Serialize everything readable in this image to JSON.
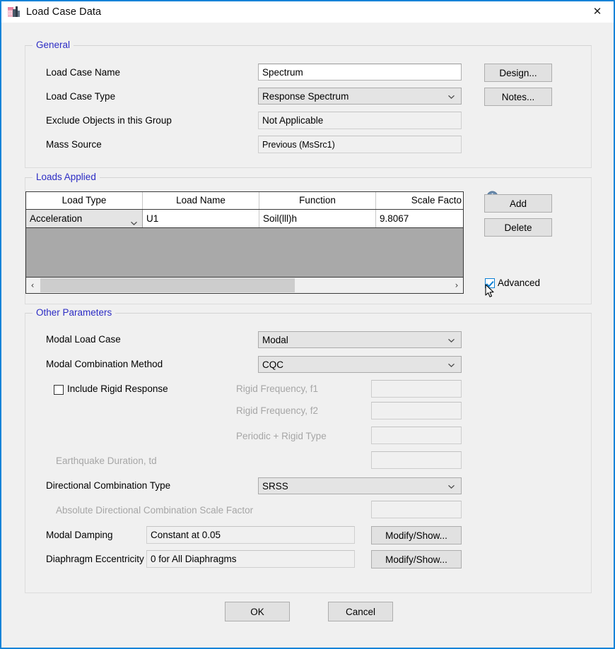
{
  "window": {
    "title": "Load Case Data",
    "icon": "app-building-icon",
    "close_label": "✕",
    "accent_border": "#1683d8"
  },
  "general": {
    "legend": "General",
    "rows": [
      {
        "label": "Load Case Name",
        "value": "Spectrum",
        "kind": "textbox"
      },
      {
        "label": "Load Case Type",
        "value": "Response Spectrum",
        "kind": "combo"
      },
      {
        "label": "Exclude Objects in this Group",
        "value": "Not Applicable",
        "kind": "flat"
      },
      {
        "label": "Mass Source",
        "value": "Previous  (MsSrc1)",
        "kind": "flat-small"
      }
    ],
    "buttons": [
      {
        "label": "Design..."
      },
      {
        "label": "Notes..."
      }
    ]
  },
  "loads_applied": {
    "legend": "Loads Applied",
    "columns": [
      "Load Type",
      "Load Name",
      "Function",
      "Scale Facto"
    ],
    "rows": [
      {
        "load_type": "Acceleration",
        "load_name": "U1",
        "function": "Soil(lll)h",
        "scale_factor": "9.8067"
      }
    ],
    "scroll_left_arrow": "‹",
    "scroll_right_arrow": "›",
    "info_icon": "info-icon",
    "buttons": [
      {
        "label": "Add"
      },
      {
        "label": "Delete"
      }
    ],
    "advanced": {
      "label": "Advanced",
      "checked": true
    }
  },
  "other_parameters": {
    "legend": "Other Parameters",
    "modal_load_case": {
      "label": "Modal Load Case",
      "value": "Modal"
    },
    "modal_combination_method": {
      "label": "Modal Combination Method",
      "value": "CQC"
    },
    "include_rigid_response": {
      "label": "Include Rigid Response",
      "checked": false
    },
    "rigid_frequency_f1": {
      "label": "Rigid Frequency, f1",
      "value": "",
      "disabled": true
    },
    "rigid_frequency_f2": {
      "label": "Rigid Frequency, f2",
      "value": "",
      "disabled": true
    },
    "periodic_rigid_type": {
      "label": "Periodic + Rigid Type",
      "value": "",
      "disabled": true
    },
    "earthquake_duration": {
      "label": "Earthquake Duration, td",
      "value": "",
      "disabled": true
    },
    "directional_combination_type": {
      "label": "Directional Combination Type",
      "value": "SRSS"
    },
    "absolute_directional_scale_factor": {
      "label": "Absolute Directional Combination Scale Factor",
      "value": "",
      "disabled": true
    },
    "modal_damping": {
      "label": "Modal Damping",
      "value": "Constant at 0.05",
      "button": "Modify/Show..."
    },
    "diaphragm_eccentricity": {
      "label": "Diaphragm Eccentricity",
      "value": "0 for All Diaphragms",
      "button": "Modify/Show..."
    }
  },
  "footer": {
    "ok_label": "OK",
    "cancel_label": "Cancel"
  }
}
